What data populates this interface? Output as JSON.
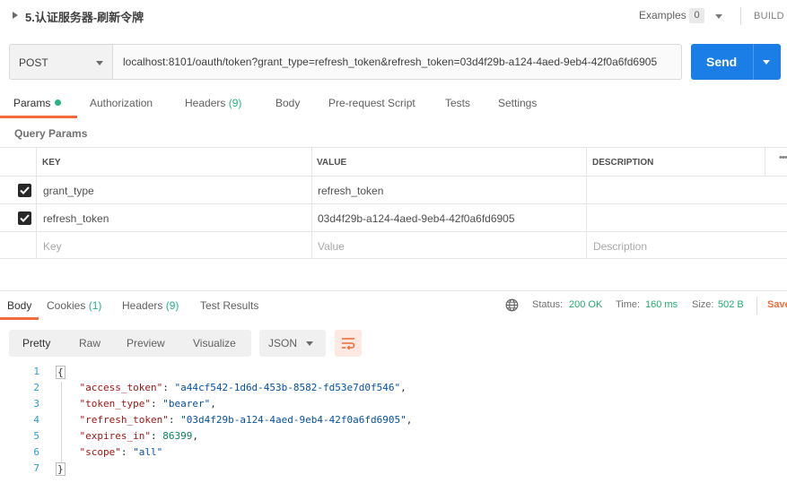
{
  "request": {
    "title": "5.认证服务器-刷新令牌",
    "examples_label": "Examples",
    "examples_count": "0",
    "build_label": "BUILD",
    "method": "POST",
    "url": "localhost:8101/oauth/token?grant_type=refresh_token&refresh_token=03d4f29b-a124-4aed-9eb4-42f0a6fd6905",
    "send_label": "Send"
  },
  "request_tabs": {
    "params": "Params",
    "authorization": "Authorization",
    "headers": "Headers",
    "headers_count": "(9)",
    "body": "Body",
    "pre_request": "Pre-request Script",
    "tests": "Tests",
    "settings": "Settings"
  },
  "query_params": {
    "title": "Query Params",
    "columns": {
      "key": "KEY",
      "value": "VALUE",
      "description": "DESCRIPTION"
    },
    "rows": [
      {
        "key": "grant_type",
        "value": "refresh_token",
        "description": "",
        "checked": true
      },
      {
        "key": "refresh_token",
        "value": "03d4f29b-a124-4aed-9eb4-42f0a6fd6905",
        "description": "",
        "checked": true
      }
    ],
    "placeholders": {
      "key": "Key",
      "value": "Value",
      "description": "Description"
    }
  },
  "response_tabs": {
    "body": "Body",
    "cookies": "Cookies",
    "cookies_count": "(1)",
    "headers": "Headers",
    "headers_count": "(9)",
    "test_results": "Test Results"
  },
  "response_status": {
    "status_label": "Status:",
    "status_value": "200 OK",
    "time_label": "Time:",
    "time_value": "160 ms",
    "size_label": "Size:",
    "size_value": "502 B",
    "save_label": "Save"
  },
  "response_view": {
    "pretty": "Pretty",
    "raw": "Raw",
    "preview": "Preview",
    "visualize": "Visualize",
    "format": "JSON"
  },
  "response_body": {
    "line_numbers": [
      "1",
      "2",
      "3",
      "4",
      "5",
      "6",
      "7"
    ],
    "open_brace": "{",
    "close_brace": "}",
    "fields": [
      {
        "key": "\"access_token\"",
        "value": "\"a44cf542-1d6d-453b-8582-fd53e7d0f546\"",
        "kind": "string"
      },
      {
        "key": "\"token_type\"",
        "value": "\"bearer\"",
        "kind": "string"
      },
      {
        "key": "\"refresh_token\"",
        "value": "\"03d4f29b-a124-4aed-9eb4-42f0a6fd6905\"",
        "kind": "string"
      },
      {
        "key": "\"expires_in\"",
        "value": "86399",
        "kind": "number"
      },
      {
        "key": "\"scope\"",
        "value": "\"all\"",
        "kind": "string"
      }
    ]
  },
  "colors": {
    "accent": "#f26b3a",
    "send": "#1a7ee6",
    "success": "#26b47f"
  },
  "icons": [
    "caret-right-icon",
    "caret-down-icon",
    "check-icon",
    "globe-icon",
    "wrap-lines-icon",
    "more-options-icon"
  ]
}
